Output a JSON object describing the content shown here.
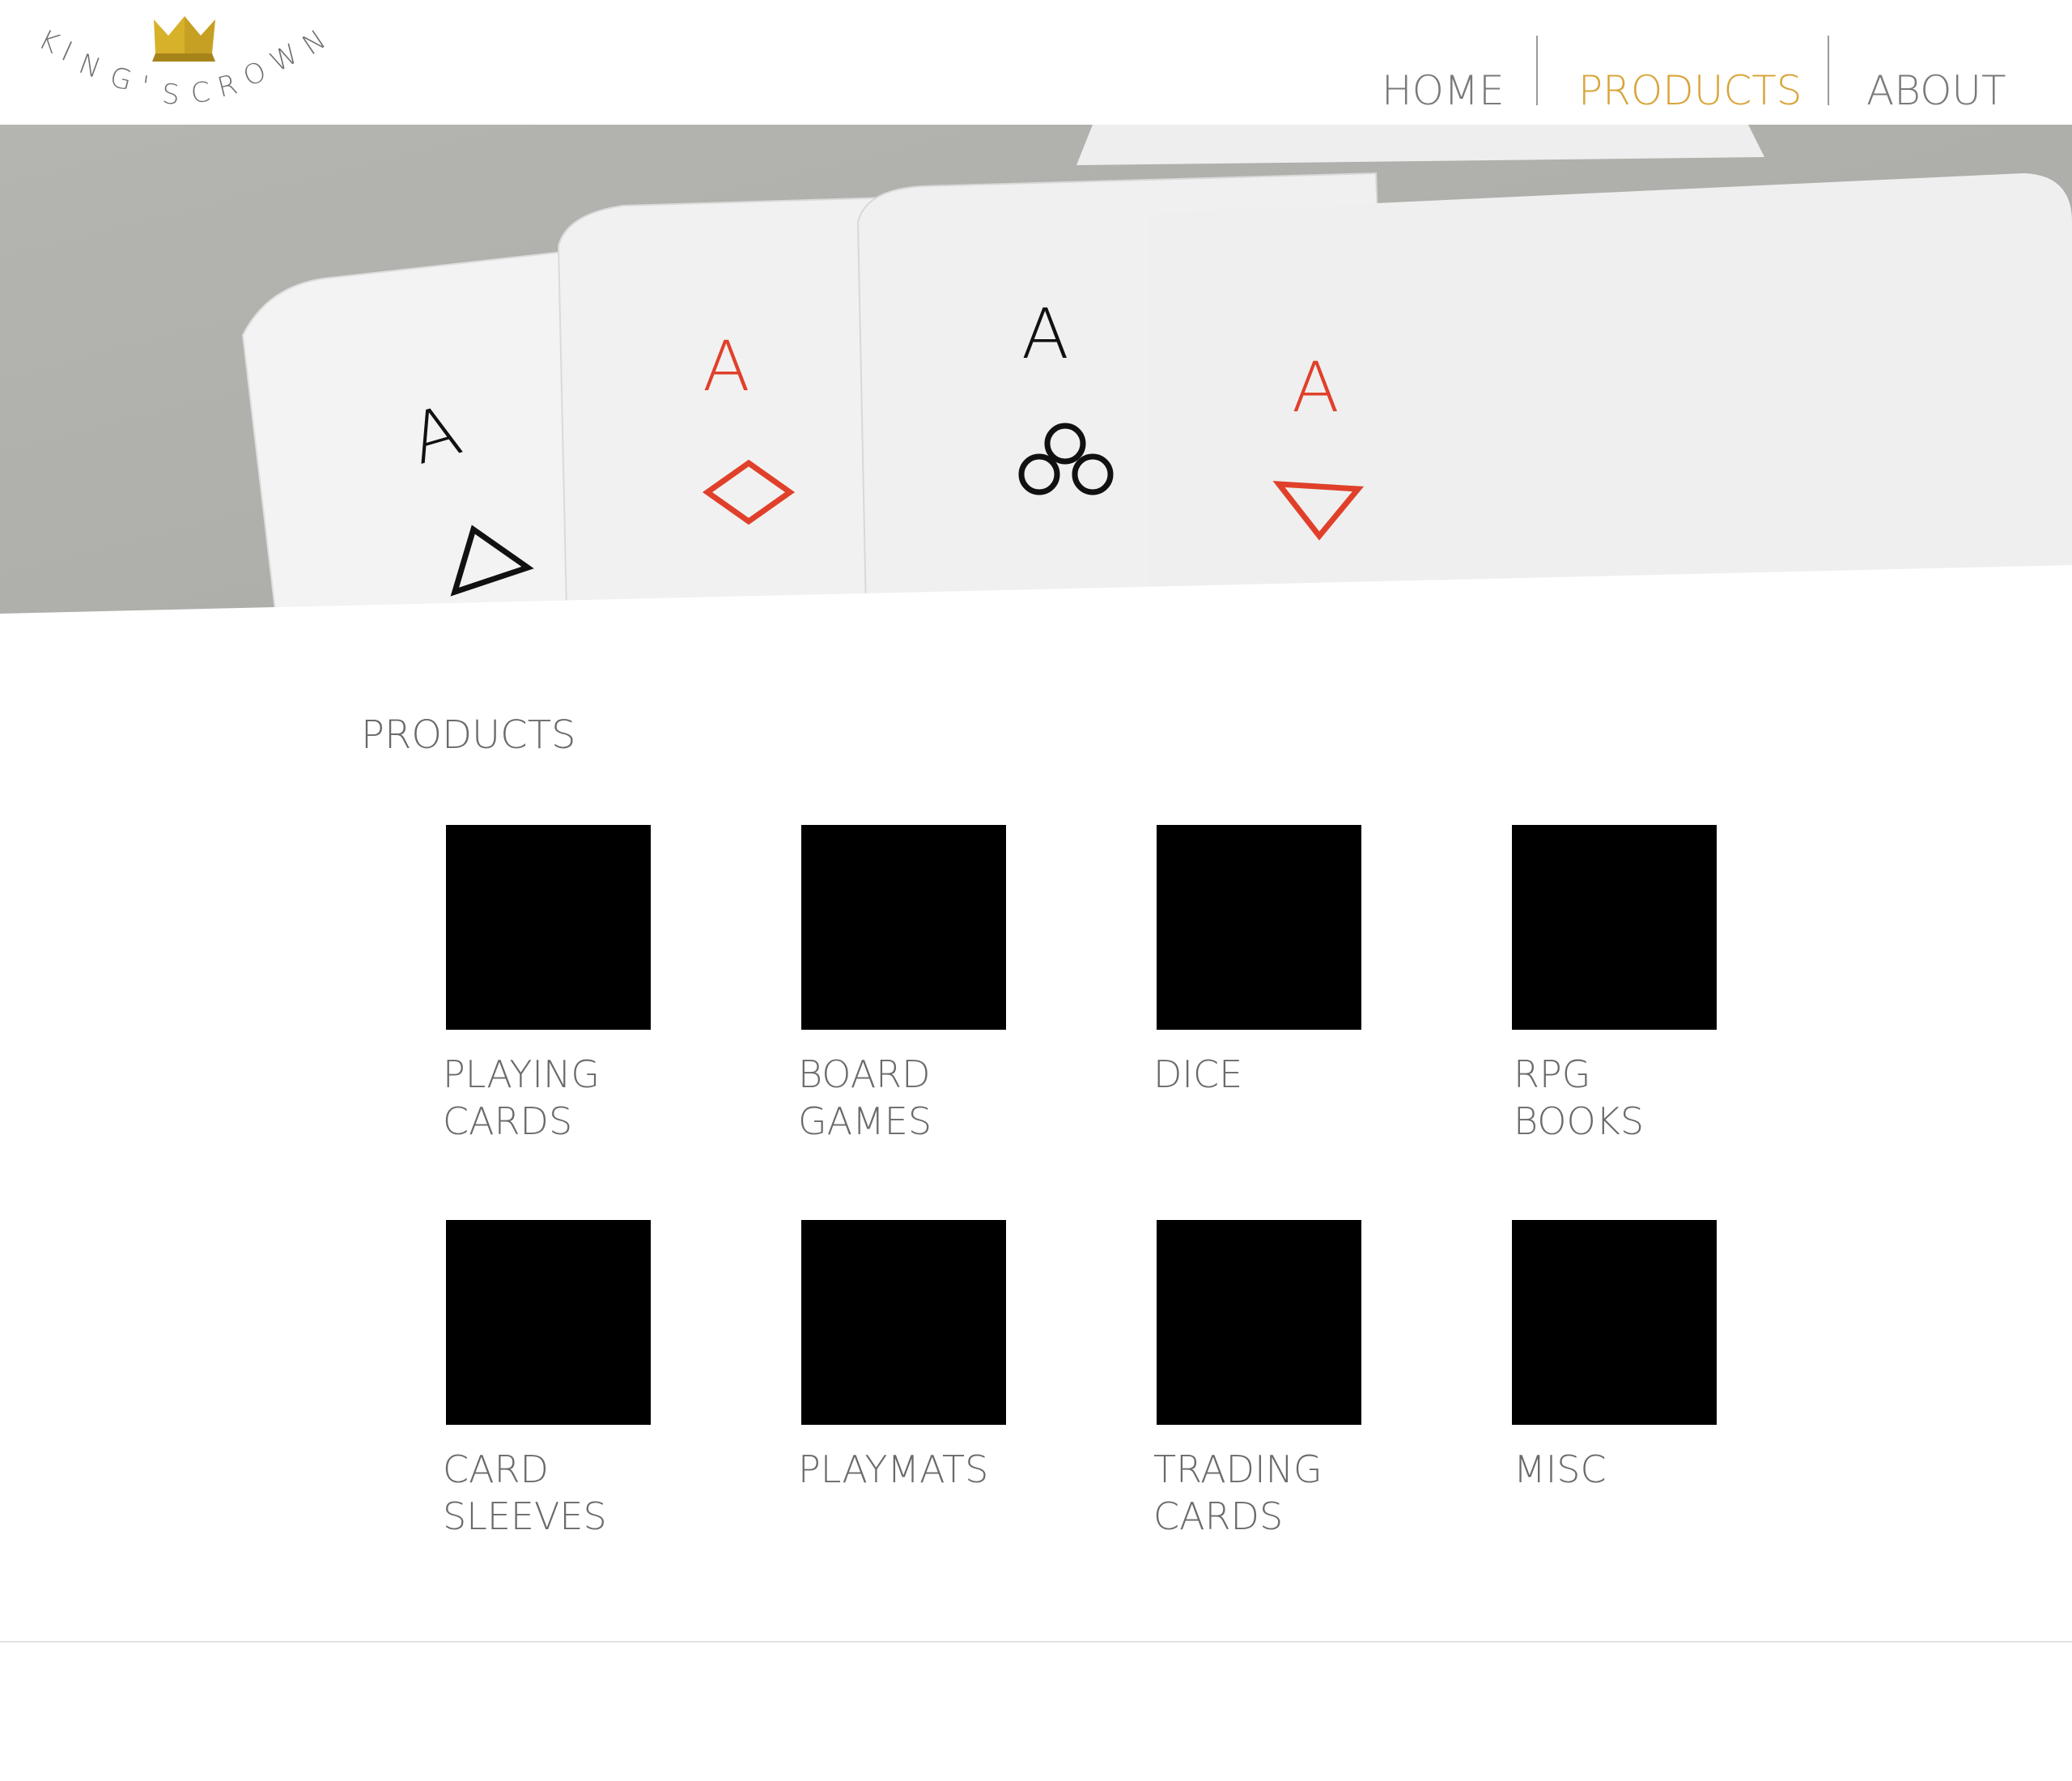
{
  "brand": {
    "name": "KING'S CROWN",
    "crown_color": "#d8b12b"
  },
  "nav": {
    "items": [
      {
        "label": "HOME",
        "active": false
      },
      {
        "label": "PRODUCTS",
        "active": true
      },
      {
        "label": "ABOUT",
        "active": false
      }
    ],
    "active_color": "#d9a43a",
    "text_color": "#7a7a7a"
  },
  "hero": {
    "cards": [
      {
        "rank": "A",
        "suit": "triangle-up",
        "color": "#111111"
      },
      {
        "rank": "A",
        "suit": "diamond",
        "color": "#e0402a"
      },
      {
        "rank": "A",
        "suit": "three-circles",
        "color": "#111111"
      },
      {
        "rank": "A",
        "suit": "triangle-down",
        "color": "#e0402a"
      }
    ]
  },
  "products": {
    "title": "PRODUCTS",
    "items": [
      {
        "label": "PLAYING\nCARDS"
      },
      {
        "label": "BOARD\nGAMES"
      },
      {
        "label": "DICE"
      },
      {
        "label": "RPG\nBOOKS"
      },
      {
        "label": "CARD\nSLEEVES"
      },
      {
        "label": "PLAYMATS"
      },
      {
        "label": "TRADING\nCARDS"
      },
      {
        "label": "MISC"
      }
    ]
  }
}
